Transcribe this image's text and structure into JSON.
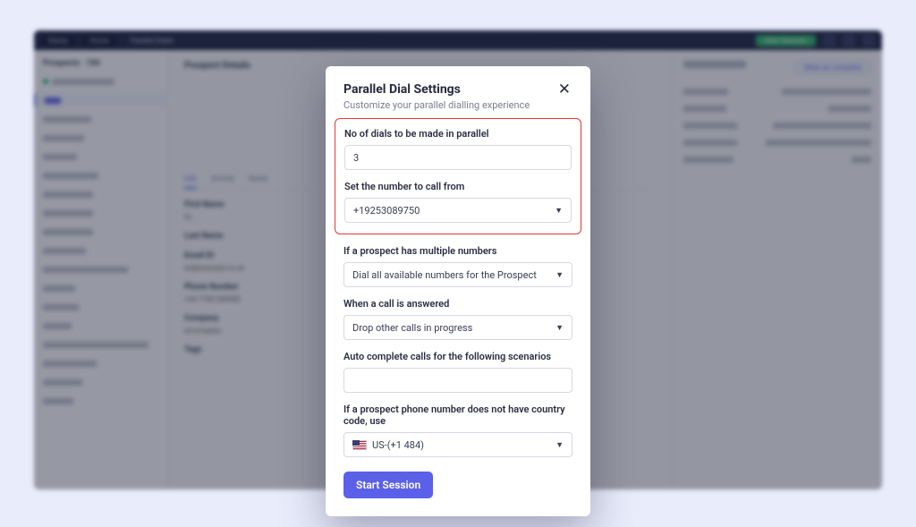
{
  "modal": {
    "title": "Parallel Dial Settings",
    "subtitle": "Customize your parallel dialling experience",
    "close_glyph": "✕",
    "dials": {
      "label": "No of dials to be made in parallel",
      "value": "3"
    },
    "call_from": {
      "label": "Set the number to call from",
      "value": "+19253089750"
    },
    "multiple_numbers": {
      "label": "If a prospect has multiple numbers",
      "value": "Dial all available numbers for the Prospect"
    },
    "on_answer": {
      "label": "When a call is answered",
      "value": "Drop other calls in progress"
    },
    "auto_complete": {
      "label": "Auto complete calls for the following scenarios",
      "value": ""
    },
    "country_code": {
      "label": "If a prospect phone number does not have country code, use",
      "value": "US-(+1 484)"
    },
    "start_button": "Start Session"
  },
  "backdrop": {
    "topbar": {
      "pill1": "Klenty",
      "pill2": "Home",
      "crumb": "Parallel Dialer",
      "cta": "Start Session"
    },
    "sidebar": {
      "header": "Prospects · 100"
    },
    "center": {
      "header": "Prospect Details",
      "name": "Ez",
      "tabs": [
        "Info",
        "Activity",
        "Notes"
      ],
      "fields": [
        {
          "label": "First Name",
          "value": "Ez"
        },
        {
          "label": "Last Name",
          "value": ""
        },
        {
          "label": "Email ID",
          "value": "ez@example.co.uk"
        },
        {
          "label": "Phone Number",
          "value": "+44 7700 000000"
        },
        {
          "label": "Company",
          "value": "ezcompany"
        },
        {
          "label": "Tags",
          "value": ""
        }
      ]
    },
    "right": {
      "header": "Call Details",
      "pill": "Mark as complete"
    }
  }
}
